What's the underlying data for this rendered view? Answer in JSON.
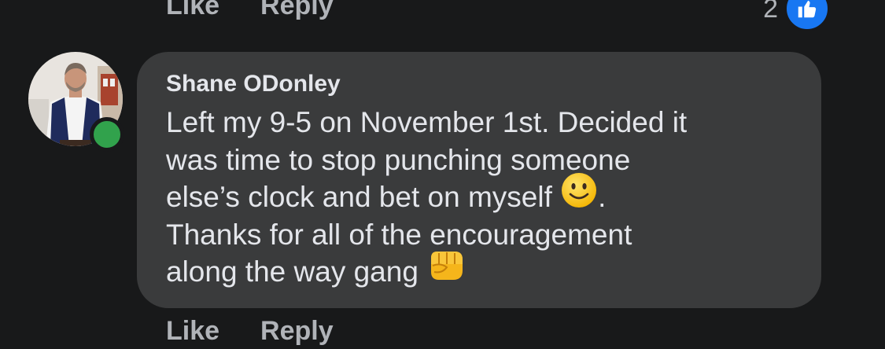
{
  "previous_comment": {
    "actions": {
      "like_label": "Like",
      "reply_label": "Reply"
    },
    "reaction_count": "2",
    "reaction_icon": "thumbs-up-icon"
  },
  "comment": {
    "author": "Shane ODonley",
    "lines": {
      "l1": "Left my 9-5 on November 1st.  Decided it",
      "l2": "was time to stop punching someone",
      "l3a": "else’s clock and bet on myself ",
      "l3b": ".",
      "l4": "Thanks for all of the encouragement",
      "l5": "along the way gang "
    },
    "emojis": [
      "slightly-smiling-face-icon",
      "oncoming-fist-icon"
    ],
    "online": true
  },
  "actions": {
    "like_label": "Like",
    "reply_label": "Reply"
  },
  "colors": {
    "background": "#18191a",
    "bubble": "#3a3b3c",
    "text": "#e4e6eb",
    "secondary_text": "#b0b3b8",
    "online": "#31a24c",
    "like_blue": "#1877f2"
  }
}
